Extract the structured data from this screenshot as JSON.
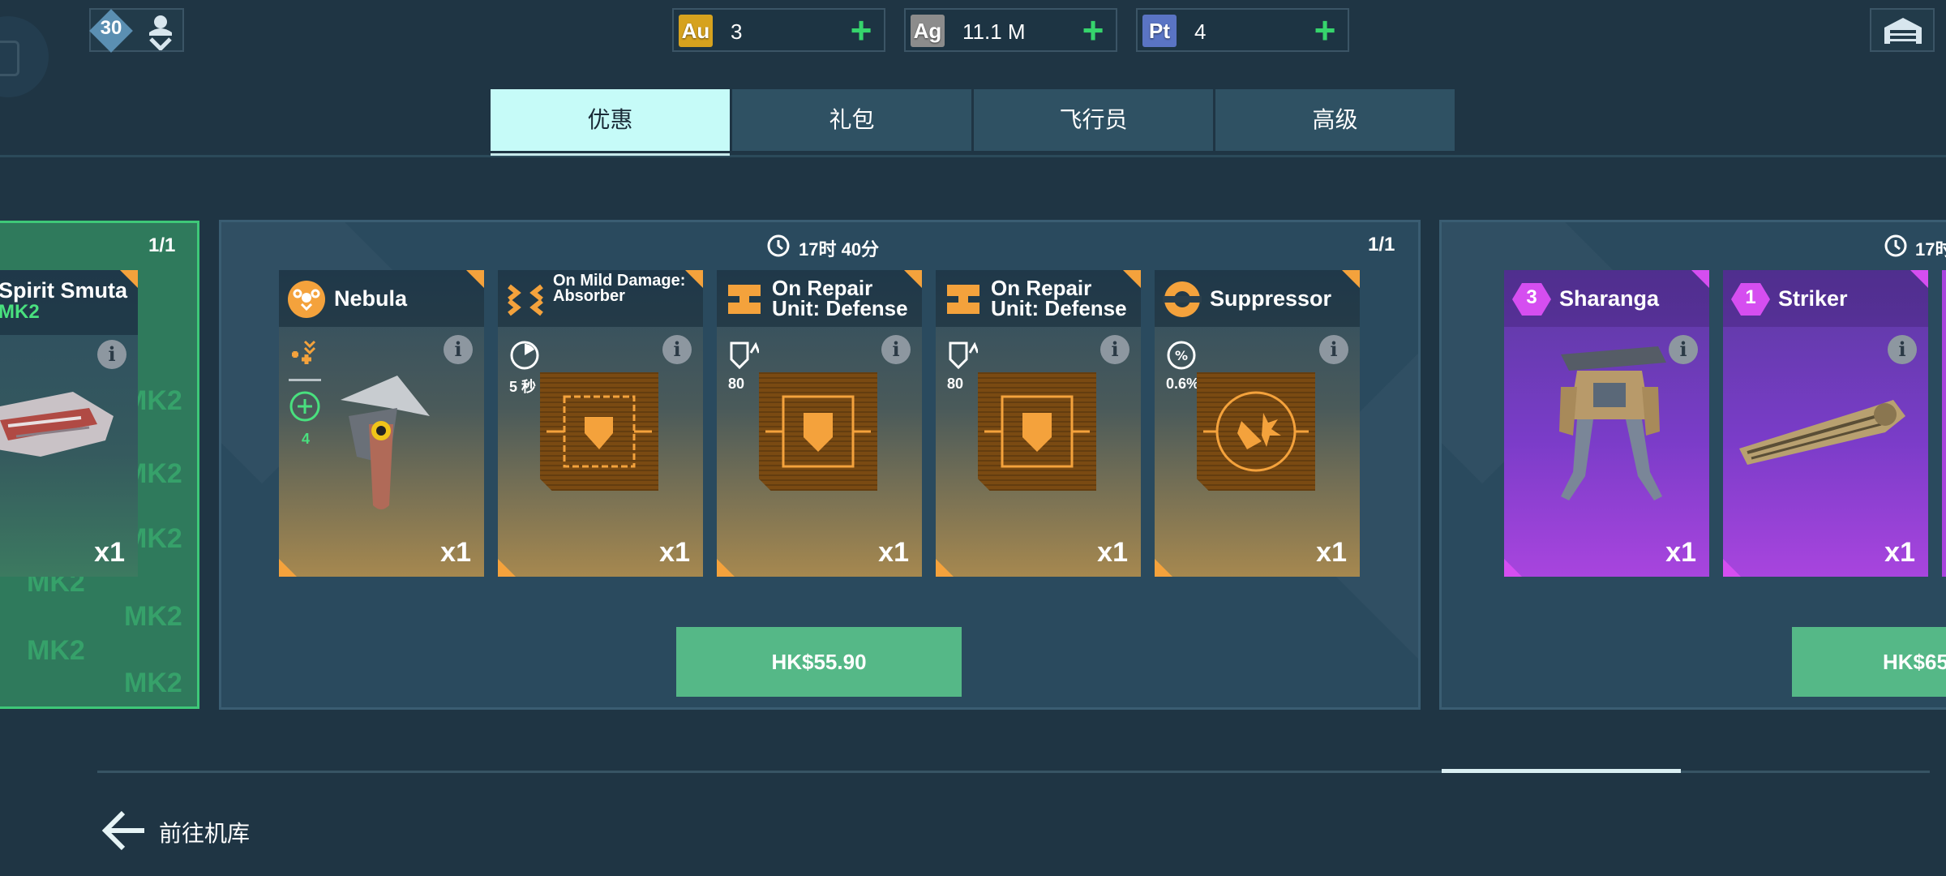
{
  "topbar": {
    "level": "30",
    "currencies": [
      {
        "badge": "Au",
        "value": "3",
        "color": "#d6a21e"
      },
      {
        "badge": "Ag",
        "value": "11.1 M",
        "color": "#8c8c8c"
      },
      {
        "badge": "Pt",
        "value": "4",
        "color": "#5a74c4"
      }
    ]
  },
  "tabs": [
    {
      "label": "优惠"
    },
    {
      "label": "礼包"
    },
    {
      "label": "飞行员"
    },
    {
      "label": "高级"
    }
  ],
  "offers": {
    "left": {
      "counter": "1/1",
      "card": {
        "title": "Spirit Smuta",
        "subtitle": "MK2",
        "qty": "x1"
      },
      "watermark": "MK2"
    },
    "center": {
      "counter": "1/1",
      "timer": "17时 40分",
      "price": "HK$55.90",
      "cards": [
        {
          "title": "Nebula",
          "qty": "x1",
          "stat": "4"
        },
        {
          "title": "On Mild Damage: Absorber",
          "qty": "x1",
          "stat": "5 秒"
        },
        {
          "title": "On Repair Unit: Defense",
          "qty": "x1",
          "stat": "80"
        },
        {
          "title": "On Repair Unit: Defense",
          "qty": "x1",
          "stat": "80"
        },
        {
          "title": "Suppressor",
          "qty": "x1",
          "stat": "0.6%"
        }
      ]
    },
    "right": {
      "timer": "17时",
      "price": "HK$65",
      "cards": [
        {
          "title": "Sharanga",
          "rank": "3",
          "qty": "x1"
        },
        {
          "title": "Striker",
          "rank": "1",
          "qty": "x1"
        }
      ]
    }
  },
  "footer": {
    "back_label": "前往机库"
  },
  "colors": {
    "accent_green": "#55b887",
    "orange": "#f4a23c",
    "purple": "#a845de",
    "tab_active": "#c6fbf8"
  }
}
